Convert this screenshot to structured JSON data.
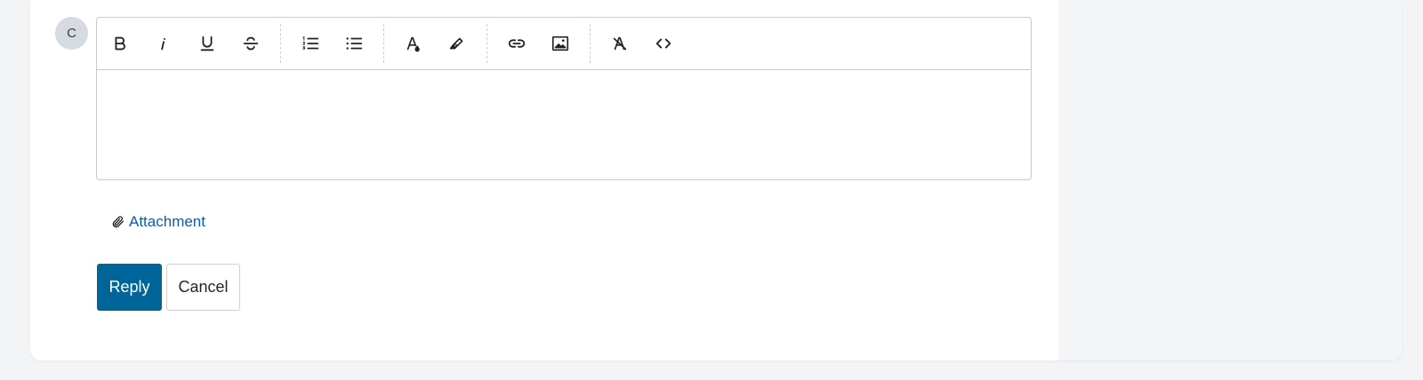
{
  "avatar": {
    "initial": "C"
  },
  "toolbar": {
    "groups": [
      [
        "bold-icon",
        "italic-icon",
        "underline-icon",
        "strikethrough-icon"
      ],
      [
        "ordered-list-icon",
        "bullet-list-icon"
      ],
      [
        "text-color-icon",
        "highlight-icon"
      ],
      [
        "link-icon",
        "image-icon"
      ],
      [
        "clear-format-icon",
        "code-icon"
      ]
    ]
  },
  "editor": {
    "content": ""
  },
  "attachment": {
    "label": "Attachment",
    "icon": "paperclip-icon"
  },
  "actions": {
    "reply_label": "Reply",
    "cancel_label": "Cancel"
  },
  "colors": {
    "primary": "#006699",
    "link": "#0b5cad",
    "border": "#c3ccd6"
  }
}
